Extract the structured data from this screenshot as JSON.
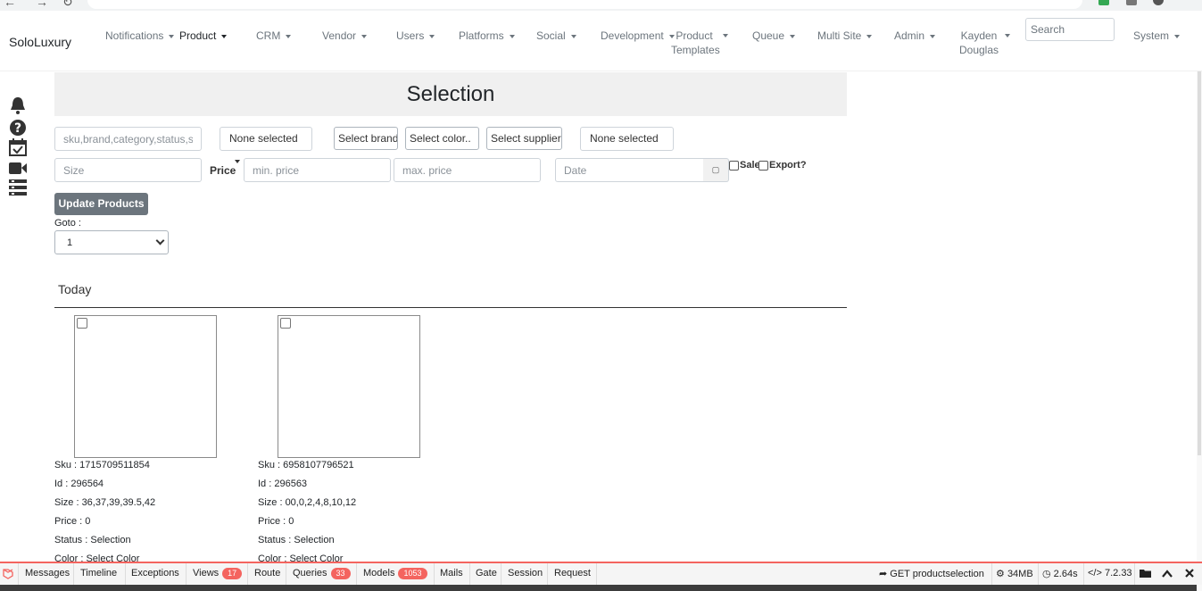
{
  "navbar": {
    "brand": "SoloLuxury",
    "items": [
      {
        "label": "Notifications",
        "active": false
      },
      {
        "label": "Product",
        "active": true
      },
      {
        "label": "CRM",
        "active": false
      },
      {
        "label": "Vendor",
        "active": false
      },
      {
        "label": "Users",
        "active": false
      },
      {
        "label": "Platforms",
        "active": false
      },
      {
        "label": "Social",
        "active": false
      },
      {
        "label": "Development",
        "active": false
      },
      {
        "label_line1": "Product",
        "label_line2": "Templates",
        "active": false
      },
      {
        "label": "Queue",
        "active": false
      },
      {
        "label": "Multi Site",
        "active": false
      },
      {
        "label": "Admin",
        "active": false
      },
      {
        "label_line1": "Kayden",
        "label_line2": "Douglas",
        "active": false
      },
      {
        "label": "System",
        "active": false
      }
    ],
    "search_placeholder": "Search"
  },
  "sidebar": {
    "icons": [
      "bell-icon",
      "question-icon",
      "calendar-check-icon",
      "video-icon",
      "list-icon"
    ]
  },
  "page": {
    "title": "Selection"
  },
  "filters": {
    "search_placeholder": "sku,brand,category,status,sta",
    "dropdown1": "None selected",
    "brand": "Select brand.",
    "color": "Select color..",
    "supplier": "Select supplier..",
    "dropdown2": "None selected",
    "size_placeholder": "Size",
    "price_label": "Price",
    "min_price_placeholder": "min. price",
    "max_price_placeholder": "max. price",
    "date_placeholder": "Date",
    "date_icon": "calendar-icon",
    "sale_label": "Sale",
    "export_label": "Export?",
    "update_button": "Update Products",
    "goto_label": "Goto :",
    "goto_value": "1"
  },
  "section": {
    "heading": "Today"
  },
  "products": [
    {
      "sku": "Sku : 1715709511854",
      "id": "Id : 296564",
      "size": "Size : 36,37,39,39.5,42",
      "price": "Price : 0",
      "status": "Status : Selection",
      "color": "Color : Select Color"
    },
    {
      "sku": "Sku : 6958107796521",
      "id": "Id : 296563",
      "size": "Size : 00,0,2,4,8,10,12",
      "price": "Price : 0",
      "status": "Status : Selection",
      "color": "Color : Select Color"
    }
  ],
  "debugbar": {
    "tabs": [
      {
        "label": "Messages"
      },
      {
        "label": "Timeline"
      },
      {
        "label": "Exceptions"
      },
      {
        "label": "Views",
        "badge": "17"
      },
      {
        "label": "Route"
      },
      {
        "label": "Queries",
        "badge": "33"
      },
      {
        "label": "Models",
        "badge": "1053"
      },
      {
        "label": "Mails"
      },
      {
        "label": "Gate"
      },
      {
        "label": "Session"
      },
      {
        "label": "Request"
      }
    ],
    "route": "GET productselection",
    "memory": "34MB",
    "time": "2.64s",
    "php": "7.2.33",
    "accent_color": "#f4645f"
  }
}
